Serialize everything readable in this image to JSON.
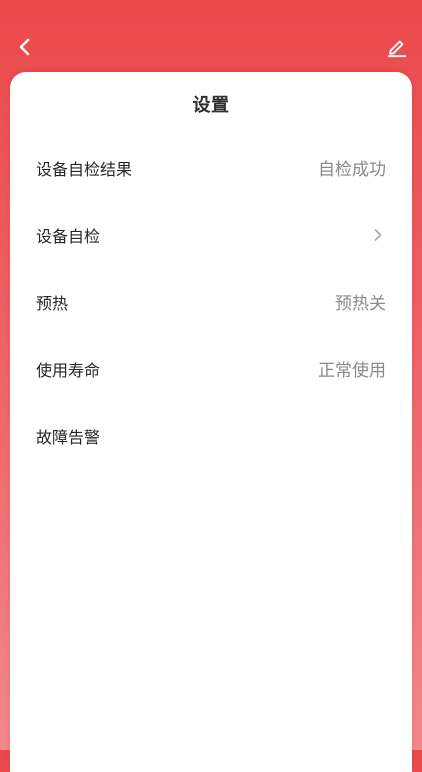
{
  "header": {
    "back_icon": "chevron-left-icon",
    "edit_icon": "pencil-icon"
  },
  "settings": {
    "title": "设置",
    "items": [
      {
        "label": "设备自检结果",
        "value": "自检成功"
      },
      {
        "label": "设备自检",
        "value": "",
        "icon": "chevron-right-icon"
      },
      {
        "label": "预热",
        "value": "预热关"
      },
      {
        "label": "使用寿命",
        "value": "正常使用"
      },
      {
        "label": "故障告警",
        "value": ""
      }
    ]
  },
  "colors": {
    "header_red": "#e9494c",
    "card_bg": "#ffffff",
    "text_primary": "#262626",
    "text_secondary": "#8a8a8a"
  }
}
